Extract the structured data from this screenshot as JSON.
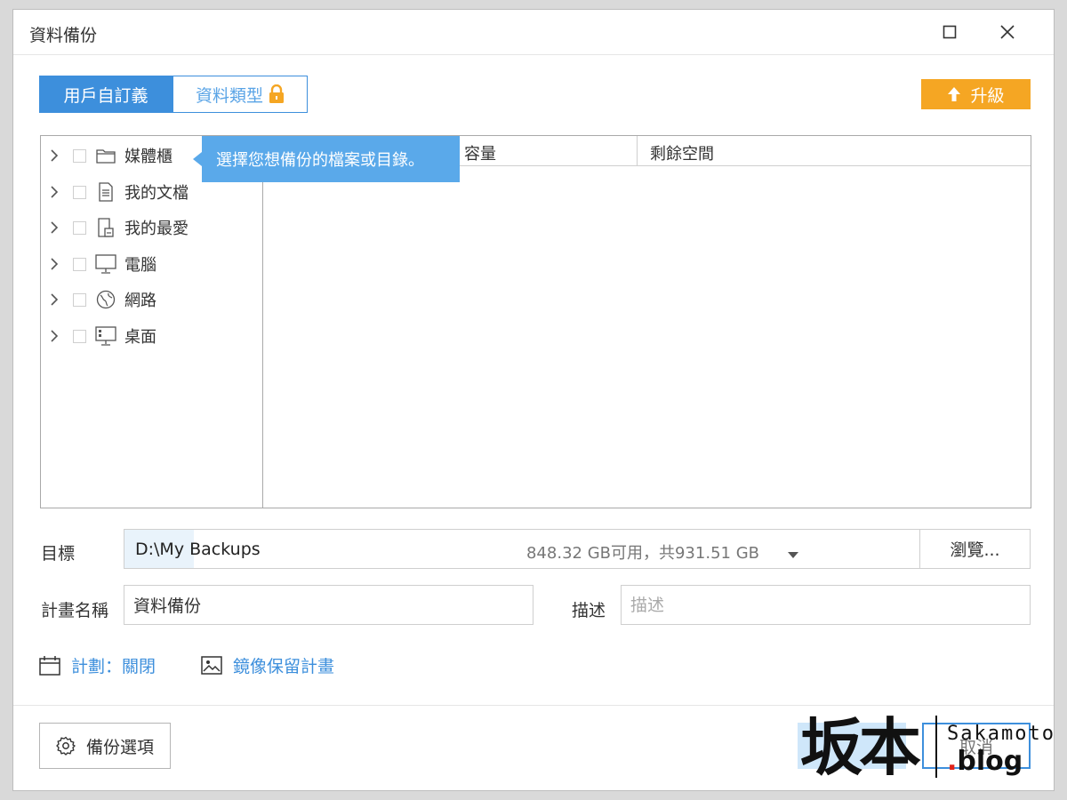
{
  "window": {
    "title": "資料備份"
  },
  "tabs": [
    {
      "label": "用戶自訂義",
      "active": true
    },
    {
      "label": "資料類型",
      "active": false,
      "icon": "lock-icon"
    }
  ],
  "upgrade": {
    "label": "升級"
  },
  "tree": {
    "items": [
      {
        "label": "媒體櫃",
        "icon": "folder-icon"
      },
      {
        "label": "我的文檔",
        "icon": "document-icon"
      },
      {
        "label": "我的最愛",
        "icon": "favorites-icon"
      },
      {
        "label": "電腦",
        "icon": "monitor-icon"
      },
      {
        "label": "網路",
        "icon": "globe-icon"
      },
      {
        "label": "桌面",
        "icon": "desktop-icon"
      }
    ]
  },
  "tooltip": {
    "text": "選擇您想備份的檔案或目錄。"
  },
  "detail": {
    "columns": [
      "容量",
      "剩餘空間"
    ]
  },
  "destination": {
    "label": "目標",
    "value": "D:\\My Backups",
    "space": "848.32 GB可用，共931.51 GB",
    "browse_label": "瀏覽..."
  },
  "plan": {
    "name_label": "計畫名稱",
    "name_value": "資料備份",
    "desc_label": "描述",
    "desc_placeholder": "描述"
  },
  "links": {
    "schedule": "計劃：關閉",
    "image_retention": "鏡像保留計畫"
  },
  "footer": {
    "options_label": "備份選項",
    "cancel_label": "取消"
  },
  "watermark": {
    "cjk": "坂本",
    "top": "Sakamoto",
    "dot": ".",
    "blog": "blog"
  },
  "colors": {
    "accent": "#3d8fdc",
    "upgrade": "#f5a623",
    "tooltip": "#5aa9ea"
  }
}
